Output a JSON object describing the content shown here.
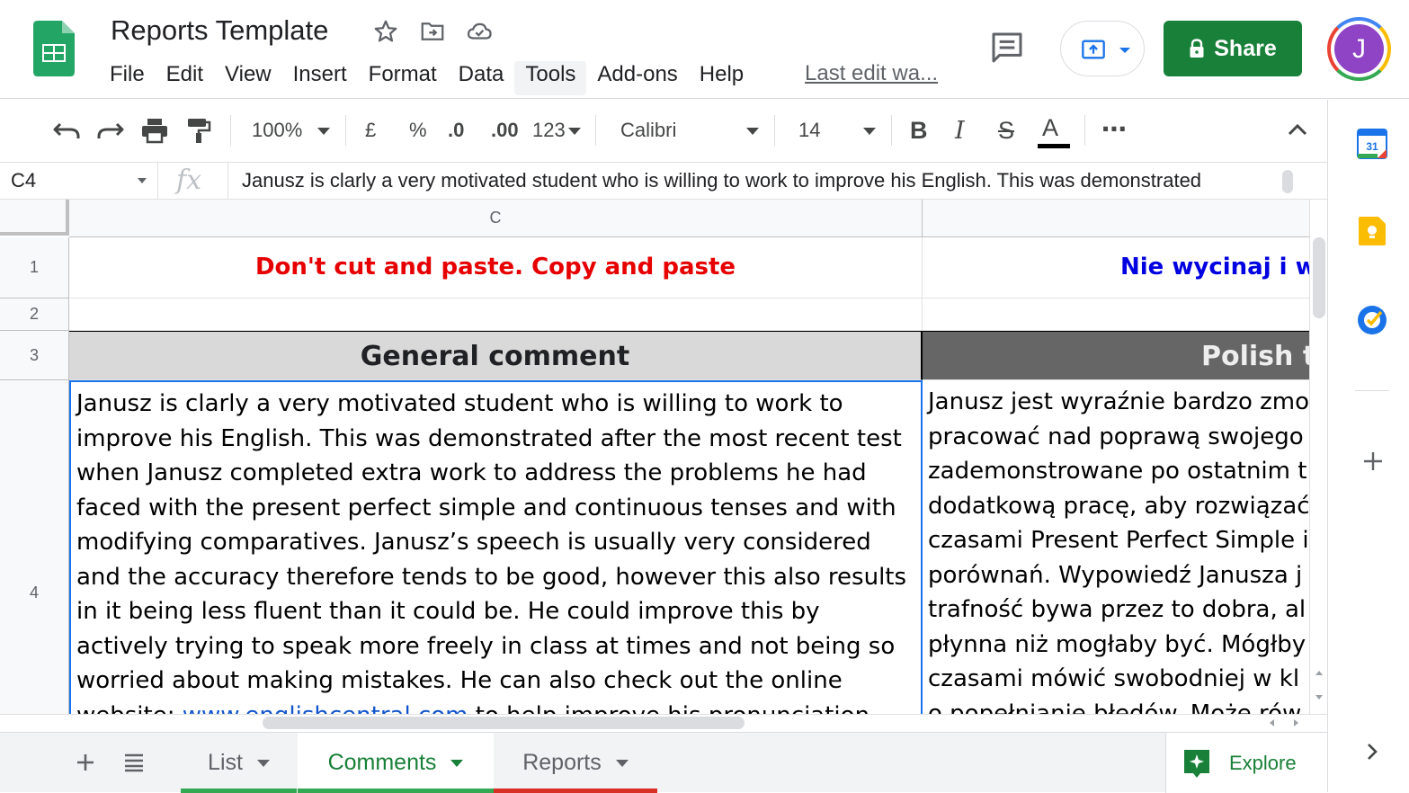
{
  "app": {
    "doc_title": "Reports Template",
    "menu": [
      "File",
      "Edit",
      "View",
      "Insert",
      "Format",
      "Data",
      "Tools",
      "Add-ons",
      "Help"
    ],
    "active_menu": "Tools",
    "last_edit": "Last edit wa...",
    "share_label": "Share",
    "avatar_initial": "J",
    "brand_color": "#188038"
  },
  "toolbar": {
    "zoom": "100%",
    "currency": "£",
    "percent": "%",
    "decrease_decimal": ".0",
    "increase_decimal": ".00",
    "more_formats": "123",
    "font": "Calibri",
    "font_size": "14",
    "bold": "B",
    "italic": "I",
    "strike": "S",
    "text_color": "A",
    "more": "⋯"
  },
  "formula_bar": {
    "cell_ref": "C4",
    "fx": "fx",
    "content": "Janusz is clarly a very motivated student who is willing to work to improve his English. This was demonstrated"
  },
  "grid": {
    "columns": [
      "C",
      ""
    ],
    "rows": [
      "1",
      "2",
      "3",
      "4"
    ],
    "r1_c": "Don't cut and paste. Copy and paste",
    "r1_d": "Nie wycinaj i wk",
    "r3_c": "General comment",
    "r3_d": "Polish tr",
    "r4_c_lines": [
      "Janusz is clarly a very motivated student who is willing to work to",
      "improve his English. This was demonstrated after the most recent test",
      "when Janusz completed extra work to address the problems he had",
      "faced with the present perfect simple and continuous tenses and with",
      "modifying comparatives. Janusz’s speech is usually very considered",
      "and the accuracy therefore tends to be good, however this also results",
      "in it being less fluent than it could be. He could improve this by",
      "actively trying to speak more freely in class at times and not being so",
      "worried about making mistakes. He can also check out the online"
    ],
    "r4_c_last_prefix": "website: ",
    "r4_c_link": "www.englishcentral.com",
    "r4_c_last_suffix": " to help improve his pronunciation",
    "r4_d_lines": [
      "Janusz jest wyraźnie bardzo zmo",
      "pracować nad poprawą swojego",
      "zademonstrowane po ostatnim t",
      "dodatkową pracę, aby rozwiązać",
      "czasami Present Perfect Simple i",
      "porównań. Wypowiedź Janusza j",
      "trafność bywa przez to dobra, al",
      "płynna niż mogłaby być. Mógłby",
      "czasami mówić swobodniej w kl",
      "o popełnianie błędów. Może rów"
    ]
  },
  "sheets": {
    "tabs": [
      "List",
      "Comments",
      "Reports"
    ],
    "active": "Comments",
    "tab_colors": [
      "#34a853",
      "#34a853",
      "#d93025"
    ],
    "explore": "Explore"
  },
  "side_panel": {
    "apps": [
      "calendar-icon",
      "keep-icon",
      "tasks-icon",
      "add-icon"
    ],
    "calendar_day": "31"
  }
}
